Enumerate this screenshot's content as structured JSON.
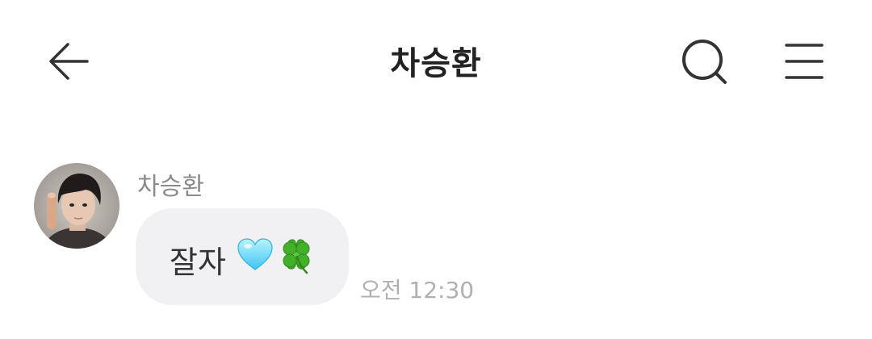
{
  "header": {
    "title": "차승환",
    "back_icon": "arrow-left-icon",
    "search_icon": "search-icon",
    "menu_icon": "hamburger-menu-icon"
  },
  "message": {
    "sender": "차승환",
    "text": "잘자",
    "emojis": [
      "light-blue-heart-emoji",
      "four-leaf-clover-emoji"
    ],
    "time": "오전 12:30"
  },
  "colors": {
    "bubble": "#f1f1f4",
    "title": "#222222",
    "meta": "#8a8a8a",
    "timestamp": "#b0b0b0"
  }
}
